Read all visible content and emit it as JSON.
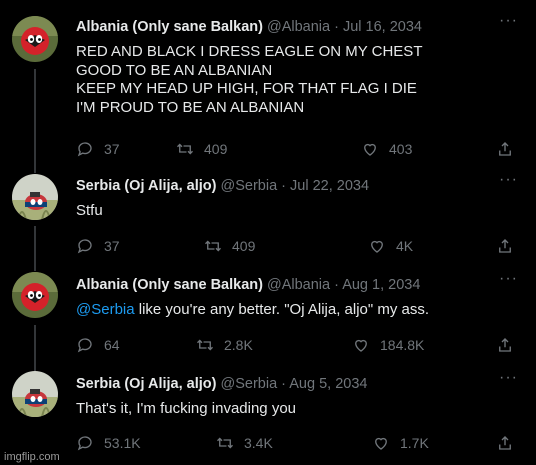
{
  "tweets": [
    {
      "name": "Albania (Only sane Balkan)",
      "handle": "@Albania",
      "sep": "·",
      "date": "Jul 16, 2034",
      "text": "RED AND BLACK I DRESS EAGLE ON MY CHEST\nGOOD TO BE AN ALBANIAN\nKEEP MY HEAD UP HIGH, FOR THAT FLAG I DIE\nI'M PROUD TO BE AN ALBANIAN",
      "replies": "37",
      "retweets": "409",
      "likes": "403",
      "avatar": "albania-countryball"
    },
    {
      "name": "Serbia (Oj Alija, aljo)",
      "handle": "@Serbia",
      "sep": "·",
      "date": "Jul 22, 2034",
      "text": "Stfu",
      "replies": "37",
      "retweets": "409",
      "likes": "4K",
      "avatar": "serbia-countryball"
    },
    {
      "name": "Albania (Only sane Balkan)",
      "handle": "@Albania",
      "sep": "·",
      "date": "Aug 1, 2034",
      "mention": "@Serbia",
      "text": " like you're any better. \"Oj Alija, aljo\" my ass.",
      "replies": "64",
      "retweets": "2.8K",
      "likes": "184.8K",
      "avatar": "albania-countryball"
    },
    {
      "name": "Serbia (Oj Alija, aljo)",
      "handle": "@Serbia",
      "sep": "·",
      "date": "Aug 5, 2034",
      "text": "That's it, I'm fucking invading you",
      "replies": "53.1K",
      "retweets": "3.4K",
      "likes": "1.7K",
      "avatar": "serbia-countryball"
    }
  ],
  "more_label": "···",
  "watermark": "imgflip.com",
  "colors": {
    "background": "#000000",
    "text": "#e7e9ea",
    "muted": "#71767b",
    "mention": "#1d9bf0"
  }
}
